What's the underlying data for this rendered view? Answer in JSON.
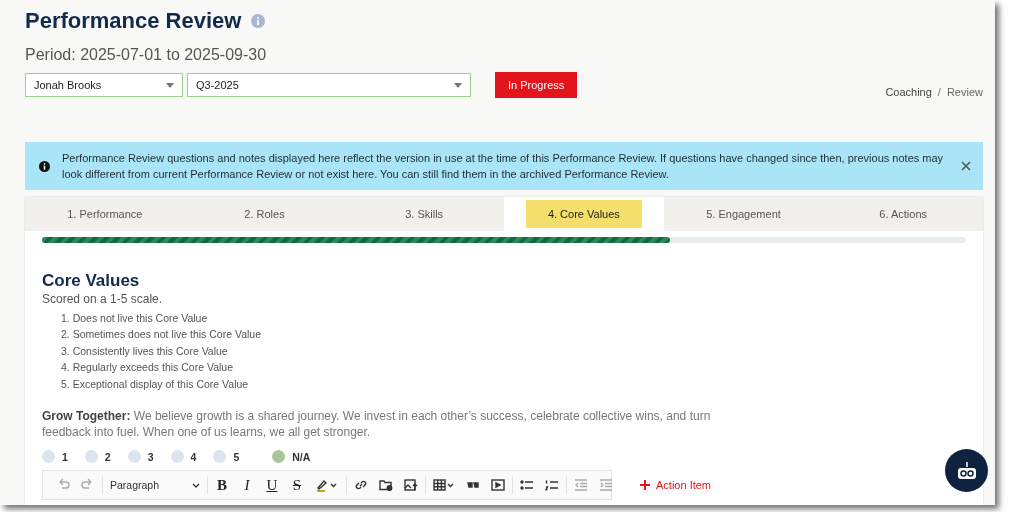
{
  "header": {
    "title": "Performance Review",
    "period": "Period: 2025-07-01 to 2025-09-30",
    "selectors": [
      {
        "value": "Jonah Brooks"
      },
      {
        "value": "Q3-2025"
      }
    ],
    "status_button": "In Progress",
    "breadcrumb": [
      "Coaching",
      "Review"
    ],
    "breadcrumb_separator": "/"
  },
  "alert": {
    "text": "Performance Review questions and notes displayed here reflect the version in use at the time of this Performance Review. If questions have changed since then, previous notes may look different from current Performance Review or not exist here. You can still find them in the archived Performance Review."
  },
  "tabs": [
    {
      "label": "1. Performance",
      "selected": false
    },
    {
      "label": "2. Roles",
      "selected": false
    },
    {
      "label": "3. Skills",
      "selected": false
    },
    {
      "label": "4. Core Values",
      "selected": true
    },
    {
      "label": "5. Engagement",
      "selected": false
    },
    {
      "label": "6. Actions",
      "selected": false
    }
  ],
  "progress": {
    "level": 0.68
  },
  "section": {
    "heading": "Core Values",
    "subtitle": "Scored on a 1-5 scale.",
    "scale": [
      "1. Does not live this Core Value",
      "2. Sometimes does not live this Core Value",
      "3. Consistently lives this Core Value",
      "4. Regularly exceeds this Core Value",
      "5. Exceptional display of this Core Value"
    ],
    "value_text": "**Grow Together:** We believe growth is a shared journey. We invest in each other’s success, celebrate collective wins, and turn feedback into fuel. When one of us learns, we all get stronger.",
    "rating": [
      {
        "label": "1",
        "selected": false
      },
      {
        "label": "2",
        "selected": false
      },
      {
        "label": "3",
        "selected": false
      },
      {
        "label": "4",
        "selected": false
      },
      {
        "label": "5",
        "selected": false
      },
      {
        "label": "N/A",
        "selected": true
      }
    ]
  },
  "toolbar": {
    "block_format": "Paragraph",
    "format_buttons": [
      "B",
      "I",
      "U",
      "S"
    ]
  },
  "action_item": "Action Item"
}
